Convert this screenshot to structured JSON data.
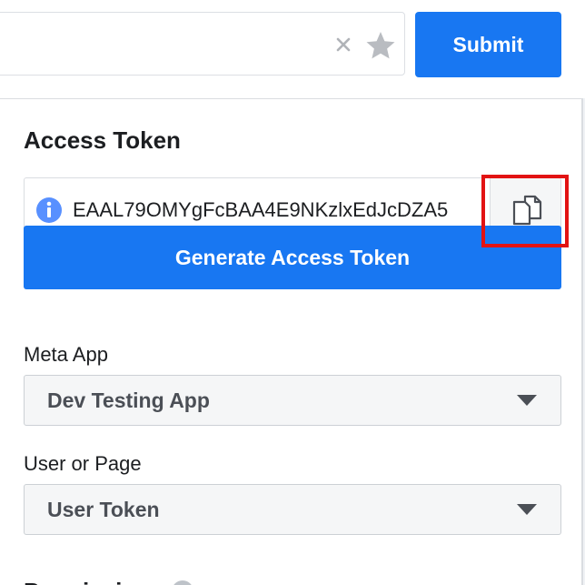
{
  "top_bar": {
    "url_value": "",
    "submit_label": "Submit"
  },
  "access_token": {
    "title": "Access Token",
    "token_value": "EAAL79OMYgFcBAA4E9NKzlxEdJcDZA5",
    "generate_label": "Generate Access Token"
  },
  "meta_app": {
    "label": "Meta App",
    "selected": "Dev Testing App"
  },
  "user_or_page": {
    "label": "User or Page",
    "selected": "User Token"
  },
  "permissions": {
    "heading": "Permissions"
  },
  "icons": {
    "clear": "close-icon",
    "star": "star-icon",
    "info": "info-icon",
    "copy": "copy-icon",
    "caret": "caret-down-icon",
    "help": "help-icon"
  },
  "colors": {
    "accent": "#1877f2",
    "highlight": "#e21313",
    "info": "#5890ff"
  }
}
